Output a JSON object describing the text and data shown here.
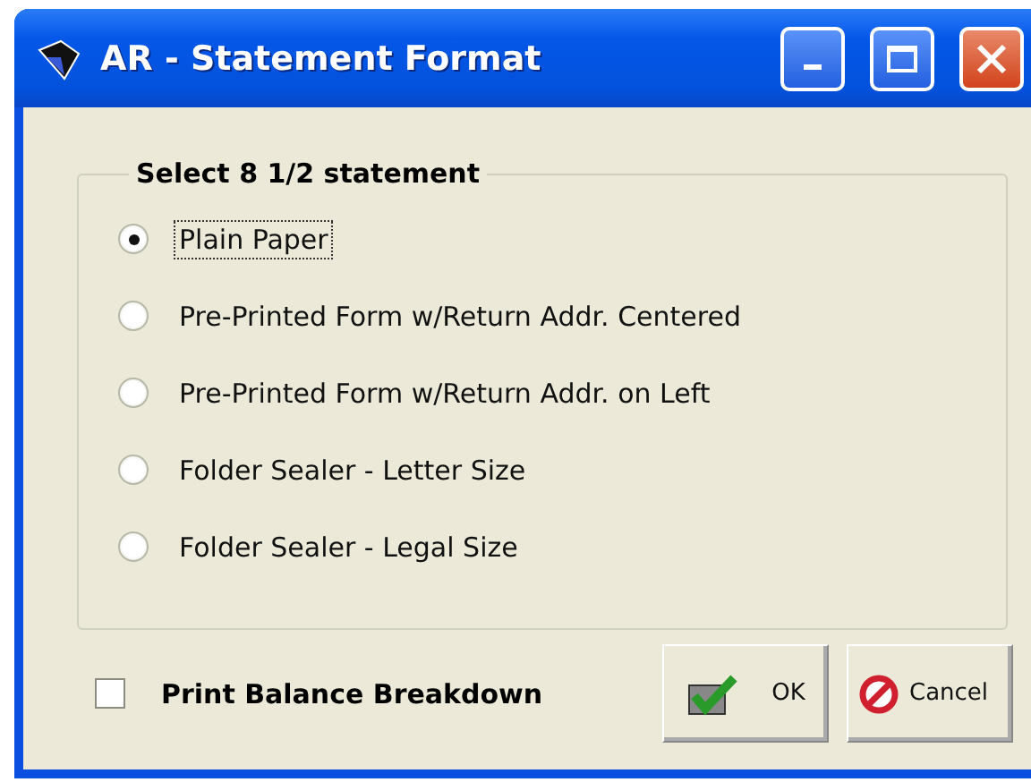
{
  "window": {
    "title": "AR - Statement Format"
  },
  "group": {
    "title": "Select 8 1/2 statement",
    "options": [
      {
        "label": "Plain Paper",
        "selected": true
      },
      {
        "label": "Pre-Printed Form w/Return Addr. Centered",
        "selected": false
      },
      {
        "label": "Pre-Printed Form w/Return Addr. on Left",
        "selected": false
      },
      {
        "label": "Folder Sealer - Letter Size",
        "selected": false
      },
      {
        "label": "Folder Sealer - Legal Size",
        "selected": false
      }
    ]
  },
  "checkbox": {
    "label": "Print Balance Breakdown",
    "checked": false
  },
  "buttons": [
    {
      "kind": "ok",
      "label": "OK"
    },
    {
      "kind": "cancel",
      "label": "Cancel"
    }
  ]
}
